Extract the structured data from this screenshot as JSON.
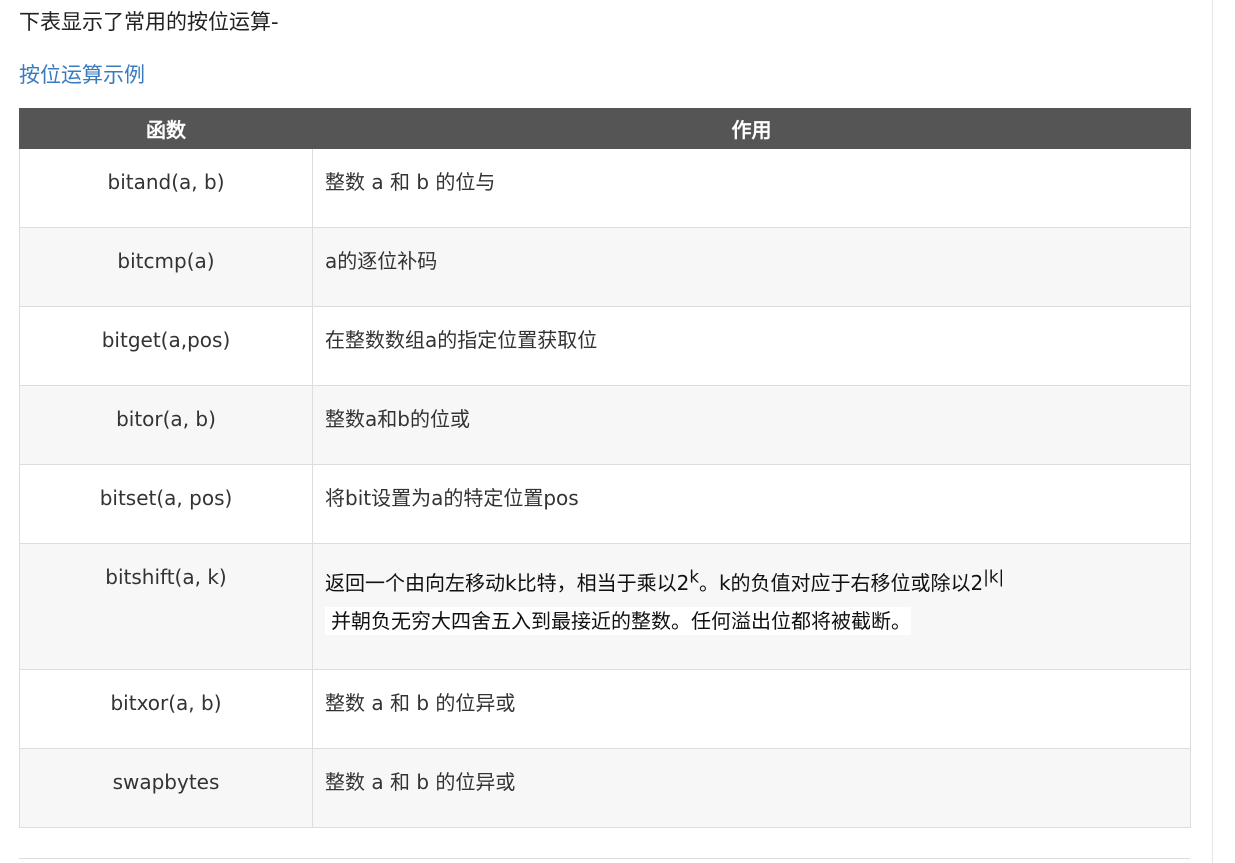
{
  "intro_text": "下表显示了常用的按位运算-",
  "example_link": "按位运算示例",
  "table": {
    "headers": [
      "函数",
      "作用"
    ],
    "rows": [
      {
        "fn": "bitand(a, b)",
        "desc": "整数 a 和 b 的位与"
      },
      {
        "fn": "bitcmp(a)",
        "desc": "a的逐位补码"
      },
      {
        "fn": "bitget(a,pos)",
        "desc": "在整数数组a的指定位置获取位"
      },
      {
        "fn": "bitor(a, b)",
        "desc": "整数a和b的位或"
      },
      {
        "fn": "bitset(a, pos)",
        "desc": "将bit设置为a的特定位置pos"
      },
      {
        "fn": "bitshift(a, k)",
        "desc_line1": "返回一个由向左移动k比特，相当于乘以2",
        "desc_sup1": "k",
        "desc_mid": "。k的负值对应于右移位或除以2",
        "desc_sup2": "|k|",
        "desc_line2": "并朝负无穷大四舍五入到最接近的整数。任何溢出位都将被截断。"
      },
      {
        "fn": "bitxor(a, b)",
        "desc": "整数 a 和 b 的位异或"
      },
      {
        "fn": "swapbytes",
        "desc": "整数 a 和 b 的位异或"
      }
    ]
  }
}
